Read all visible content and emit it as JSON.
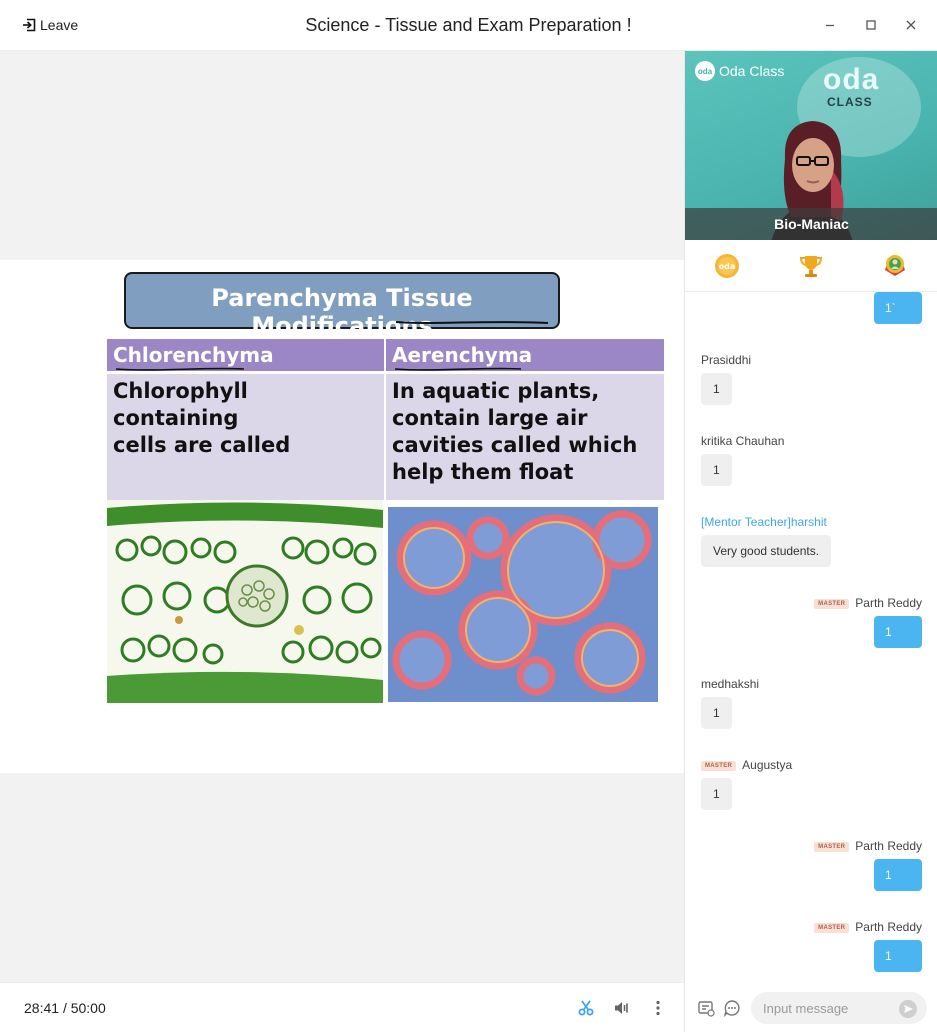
{
  "titlebar": {
    "leave_label": "Leave",
    "title": "Science - Tissue and Exam Preparation !"
  },
  "slide": {
    "title": "Parenchyma Tissue Modifications",
    "columns": [
      {
        "heading": "Chlorenchyma",
        "text": "Chlorophyll containing\ncells are called",
        "image": "chlorenchyma-micrograph"
      },
      {
        "heading": "Aerenchyma",
        "text": "In aquatic plants,\ncontain large air\ncavities called which\nhelp them float",
        "image": "aerenchyma-micrograph"
      }
    ]
  },
  "video": {
    "brand": "Oda Class",
    "brand_dot": "oda",
    "board_line1": "oda",
    "board_line2": "CLASS",
    "presenter_name": "Bio-Maniac"
  },
  "toolbar_icons": [
    "oda-coin-icon",
    "trophy-icon",
    "award-badge-icon"
  ],
  "chat": {
    "master_badge": "MASTER",
    "messages": [
      {
        "side": "right",
        "name": "",
        "text": "1`"
      },
      {
        "side": "left",
        "name": "Prasiddhi",
        "text": "1"
      },
      {
        "side": "left",
        "name": "kritika Chauhan",
        "text": "1"
      },
      {
        "side": "left",
        "name": "[Mentor Teacher]harshit",
        "text": "Very good students.",
        "mentor": true
      },
      {
        "side": "right",
        "name": "Parth Reddy",
        "text": "1",
        "master": true
      },
      {
        "side": "left",
        "name": "medhakshi",
        "text": "1"
      },
      {
        "side": "left",
        "name": "Augustya",
        "text": "1",
        "master": true
      },
      {
        "side": "right",
        "name": "Parth Reddy",
        "text": "1",
        "master": true
      },
      {
        "side": "right",
        "name": "Parth Reddy",
        "text": "1",
        "master": true
      }
    ],
    "input_placeholder": "Input message"
  },
  "bottom": {
    "elapsed": "28:41",
    "separator": "/",
    "total": "50:00"
  },
  "colors": {
    "accent": "#4bb5f1",
    "mentor": "#3ea6e8",
    "slide_title_bg": "#7f9ec0",
    "column_header_bg": "#9b87c6",
    "column_body_bg": "#dcd7e8"
  }
}
